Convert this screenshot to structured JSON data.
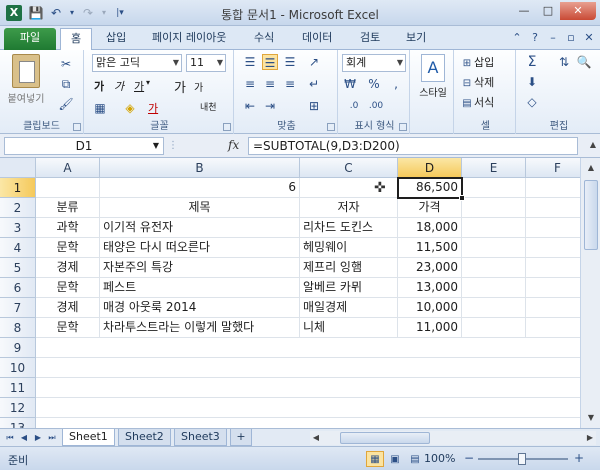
{
  "window": {
    "title": "통합 문서1  -  Microsoft Excel"
  },
  "ribbon_tabs": [
    {
      "label": "파일"
    },
    {
      "label": "홈"
    },
    {
      "label": "삽입"
    },
    {
      "label": "페이지 레이아웃"
    },
    {
      "label": "수식"
    },
    {
      "label": "데이터"
    },
    {
      "label": "검토"
    },
    {
      "label": "보기"
    }
  ],
  "ribbon": {
    "clipboard": {
      "paste_label": "붙여넣기",
      "group_label": "클립보드"
    },
    "font": {
      "font_name": "맑은 고딕",
      "font_size": "11",
      "group_label": "글꼴",
      "bold": "가",
      "italic": "가",
      "underline": "가",
      "font_color": "가",
      "grow": "가",
      "shrink": "가",
      "phonetic": "내천"
    },
    "alignment": {
      "group_label": "맞춤"
    },
    "number": {
      "format": "회계",
      "group_label": "표시 형식"
    },
    "styles": {
      "label": "스타일"
    },
    "cells": {
      "insert": "삽입",
      "delete": "삭제",
      "format": "서식",
      "group_label": "셀"
    },
    "editing": {
      "group_label": "편집"
    }
  },
  "formula_bar": {
    "name_box": "D1",
    "fx": "fx",
    "formula": "=SUBTOTAL(9,D3:D200)"
  },
  "columns": [
    "A",
    "B",
    "C",
    "D",
    "E",
    "F"
  ],
  "rows": [
    "1",
    "2",
    "3",
    "4",
    "5",
    "6",
    "7",
    "8",
    "9",
    "10",
    "11",
    "12",
    "13"
  ],
  "cells": {
    "r1": {
      "b": "6",
      "d": "86,500"
    },
    "header": {
      "a": "분류",
      "b": "제목",
      "c": "저자",
      "d": "가격"
    },
    "data": [
      {
        "a": "과학",
        "b": "이기적 유전자",
        "c": "리차드 도킨스",
        "d": "18,000"
      },
      {
        "a": "문학",
        "b": "태양은 다시 떠오른다",
        "c": "헤밍웨이",
        "d": "11,500"
      },
      {
        "a": "경제",
        "b": "자본주의 특강",
        "c": "제프리 잉햄",
        "d": "23,000"
      },
      {
        "a": "문학",
        "b": "페스트",
        "c": "알베르 카뮈",
        "d": "13,000"
      },
      {
        "a": "경제",
        "b": "매경 아웃룩 2014",
        "c": "매일경제",
        "d": "10,000"
      },
      {
        "a": "문학",
        "b": "차라투스트라는 이렇게 말했다",
        "c": "니체",
        "d": "11,000"
      }
    ]
  },
  "sheets": [
    {
      "label": "Sheet1"
    },
    {
      "label": "Sheet2"
    },
    {
      "label": "Sheet3"
    }
  ],
  "status": {
    "ready": "준비",
    "zoom": "100%"
  }
}
